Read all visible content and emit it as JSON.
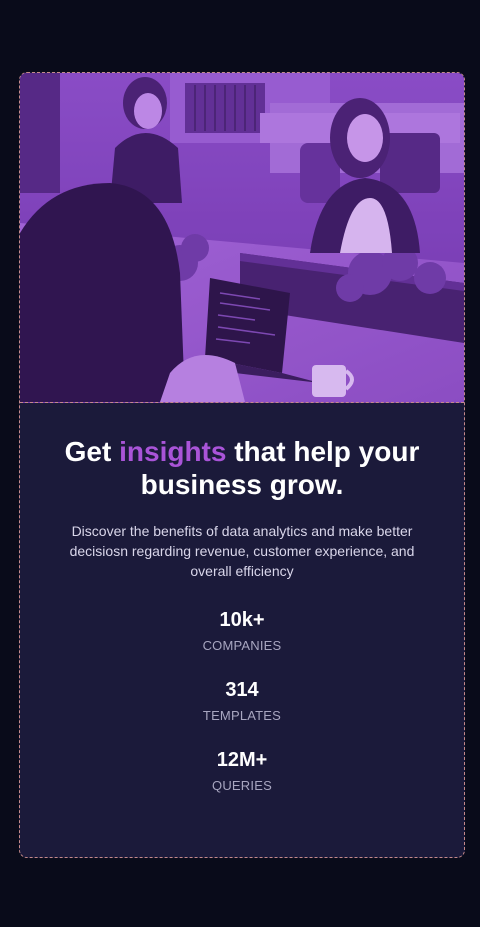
{
  "hero": {
    "image_alt": "Women working on laptops in an office",
    "tint_color": "#8a45c8"
  },
  "headline": {
    "part1": "Get ",
    "accent": "insights",
    "part2": " that help your business grow."
  },
  "description": "Discover the benefits of data analytics and make better decisiosn regarding revenue, customer experience, and overall efficiency",
  "stats": [
    {
      "value": "10k+",
      "label": "COMPANIES"
    },
    {
      "value": "314",
      "label": "TEMPLATES"
    },
    {
      "value": "12M+",
      "label": "QUERIES"
    }
  ],
  "colors": {
    "background": "#090b1a",
    "card": "#1b1a3a",
    "accent": "#a954d8",
    "border": "#c58a8a"
  }
}
